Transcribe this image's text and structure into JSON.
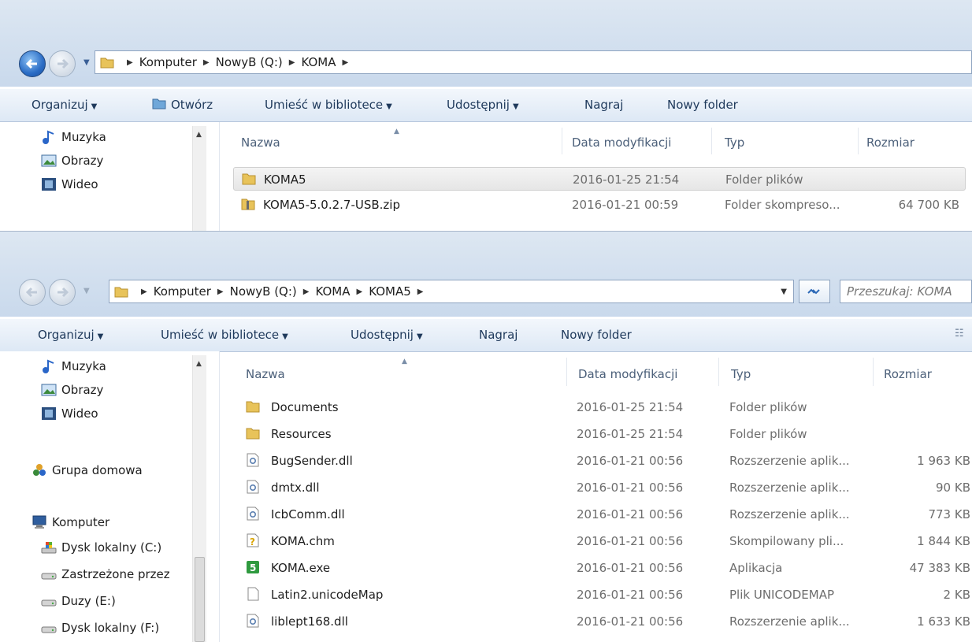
{
  "window1": {
    "breadcrumb": [
      "Komputer",
      "NowyB (Q:)",
      "KOMA"
    ],
    "toolbar": {
      "organize": "Organizuj",
      "open": "Otwórz",
      "library": "Umieść w bibliotece",
      "share": "Udostępnij",
      "burn": "Nagraj",
      "new_folder": "Nowy folder"
    },
    "nav": [
      "Muzyka",
      "Obrazy",
      "Wideo"
    ],
    "columns": {
      "name": "Nazwa",
      "date": "Data modyfikacji",
      "type": "Typ",
      "size": "Rozmiar"
    },
    "files": [
      {
        "name": "KOMA5",
        "date": "2016-01-25 21:54",
        "type": "Folder plików",
        "size": "",
        "icon": "folder-icon",
        "selected": true
      },
      {
        "name": "KOMA5-5.0.2.7-USB.zip",
        "date": "2016-01-21 00:59",
        "type": "Folder skompreso...",
        "size": "64 700 KB",
        "icon": "zip-folder-icon",
        "selected": false
      }
    ]
  },
  "window2": {
    "breadcrumb": [
      "Komputer",
      "NowyB (Q:)",
      "KOMA",
      "KOMA5"
    ],
    "search_placeholder": "Przeszukaj: KOMA",
    "toolbar": {
      "organize": "Organizuj",
      "library": "Umieść w bibliotece",
      "share": "Udostępnij",
      "burn": "Nagraj",
      "new_folder": "Nowy folder"
    },
    "nav": {
      "libraries": [
        "Muzyka",
        "Obrazy",
        "Wideo"
      ],
      "homegroup": "Grupa domowa",
      "computer": "Komputer",
      "drives": [
        "Dysk lokalny (C:)",
        "Zastrzeżone przez",
        "Duzy (E:)",
        "Dysk lokalny (F:)"
      ]
    },
    "columns": {
      "name": "Nazwa",
      "date": "Data modyfikacji",
      "type": "Typ",
      "size": "Rozmiar"
    },
    "files": [
      {
        "name": "Documents",
        "date": "2016-01-25 21:54",
        "type": "Folder plików",
        "size": "",
        "icon": "folder-icon"
      },
      {
        "name": "Resources",
        "date": "2016-01-25 21:54",
        "type": "Folder plików",
        "size": "",
        "icon": "folder-icon"
      },
      {
        "name": "BugSender.dll",
        "date": "2016-01-21 00:56",
        "type": "Rozszerzenie aplik...",
        "size": "1 963 KB",
        "icon": "dll-icon"
      },
      {
        "name": "dmtx.dll",
        "date": "2016-01-21 00:56",
        "type": "Rozszerzenie aplik...",
        "size": "90 KB",
        "icon": "dll-icon"
      },
      {
        "name": "IcbComm.dll",
        "date": "2016-01-21 00:56",
        "type": "Rozszerzenie aplik...",
        "size": "773 KB",
        "icon": "dll-icon"
      },
      {
        "name": "KOMA.chm",
        "date": "2016-01-21 00:56",
        "type": "Skompilowany pli...",
        "size": "1 844 KB",
        "icon": "help-file-icon"
      },
      {
        "name": "KOMA.exe",
        "date": "2016-01-21 00:56",
        "type": "Aplikacja",
        "size": "47 383 KB",
        "icon": "koma-app-icon"
      },
      {
        "name": "Latin2.unicodeMap",
        "date": "2016-01-21 00:56",
        "type": "Plik UNICODEMAP",
        "size": "2 KB",
        "icon": "blank-file-icon"
      },
      {
        "name": "liblept168.dll",
        "date": "2016-01-21 00:56",
        "type": "Rozszerzenie aplik...",
        "size": "1 633 KB",
        "icon": "dll-icon"
      }
    ]
  },
  "colors": {
    "titlebar": "#d3e0ef",
    "toolbar": "#e6eef8",
    "toolbar_text": "#1e395b",
    "header_text": "#4c607a",
    "meta_text": "#6d6d6d"
  }
}
